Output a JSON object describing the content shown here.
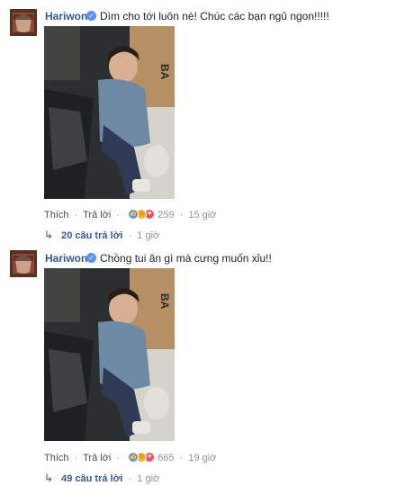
{
  "comments": [
    {
      "author": "Hariwon",
      "text": "Dìm cho tới luôn nè! Chúc các bạn ngủ ngon!!!!!",
      "photo_label": "BA",
      "actions": {
        "like": "Thích",
        "reply": "Trả lời",
        "reactions_count": "259",
        "time": "15 giờ"
      },
      "replies": {
        "count_text": "20 câu trả lời",
        "time": "1 giờ"
      }
    },
    {
      "author": "Hariwon",
      "text": "Chồng tui ăn gì mà cưng muốn xỉu!!",
      "photo_label": "BA",
      "actions": {
        "like": "Thích",
        "reply": "Trả lời",
        "reactions_count": "665",
        "time": "19 giờ"
      },
      "replies": {
        "count_text": "49 câu trả lời",
        "time": "1 giờ"
      }
    }
  ],
  "separator": "·",
  "icons": [
    "verified-badge-icon",
    "like-reaction-icon",
    "haha-reaction-icon",
    "love-reaction-icon",
    "reply-arrow-icon"
  ],
  "colors": {
    "link": "#365899",
    "meta": "#90949c",
    "verified": "#5890ff"
  }
}
